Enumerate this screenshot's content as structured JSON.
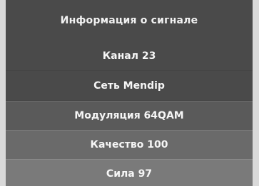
{
  "window": {
    "title": "Информация о сигнале"
  },
  "signal_info": {
    "rows": [
      {
        "label": "Канал 23"
      },
      {
        "label": "Сеть Mendip"
      },
      {
        "label": "Модуляция 64QAM"
      },
      {
        "label": "Качество 100"
      },
      {
        "label": "Сила 97"
      }
    ]
  },
  "colors": {
    "panel_bg": "#4a4a4a",
    "text": "#f2f2f2"
  }
}
